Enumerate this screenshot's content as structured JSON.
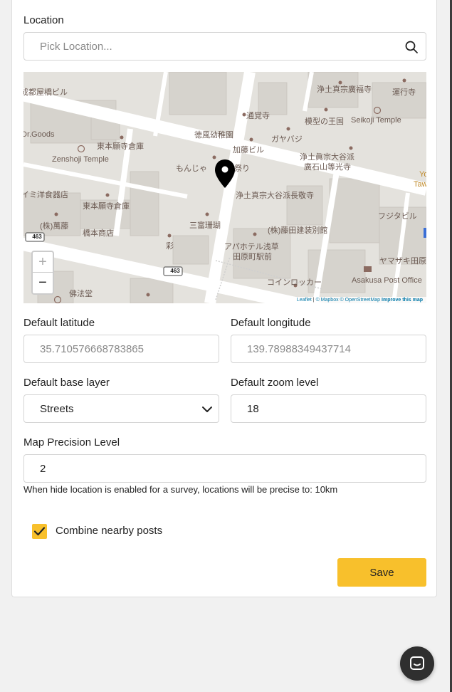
{
  "location": {
    "label": "Location",
    "placeholder": "Pick Location..."
  },
  "map": {
    "labels": [
      {
        "name": "map-label-1",
        "text": "成都屋橋ビル"
      },
      {
        "name": "map-label-2",
        "text": "Dr.Goods"
      },
      {
        "name": "map-label-3",
        "text": "東本願寺倉庫"
      },
      {
        "name": "map-label-4",
        "text": "Zenshoji Temple"
      },
      {
        "name": "map-label-5",
        "text": "イミ洋食器店"
      },
      {
        "name": "map-label-6",
        "text": "東本願寺倉庫"
      },
      {
        "name": "map-label-7",
        "text": "(株)萬藤"
      },
      {
        "name": "map-label-8",
        "text": "橋本商店"
      },
      {
        "name": "map-label-9",
        "text": "徳風幼稚園"
      },
      {
        "name": "map-label-10",
        "text": "通覚寺"
      },
      {
        "name": "map-label-11",
        "text": "浄土真宗廣福寺"
      },
      {
        "name": "map-label-12",
        "text": "運行寺"
      },
      {
        "name": "map-label-13",
        "text": "模型の王国"
      },
      {
        "name": "map-label-14",
        "text": "Seikoji Temple"
      },
      {
        "name": "map-label-15",
        "text": "ガヤバジ"
      },
      {
        "name": "map-label-16",
        "text": "加藤ビル"
      },
      {
        "name": "map-label-17",
        "text": "浄土眞宗大谷派"
      },
      {
        "name": "map-label-18",
        "text": "廣石山等光寺"
      },
      {
        "name": "map-label-19",
        "text": "もんじゃ"
      },
      {
        "name": "map-label-20",
        "text": "祭り"
      },
      {
        "name": "map-label-21",
        "text": "浄土真宗大谷派長敬寺"
      },
      {
        "name": "map-label-22",
        "text": "フジタビル"
      },
      {
        "name": "map-label-23",
        "text": "三富珊瑚"
      },
      {
        "name": "map-label-24",
        "text": "(株)藤田建装別館"
      },
      {
        "name": "map-label-25",
        "text": "彩"
      },
      {
        "name": "map-label-26",
        "text": "アパホテル浅草"
      },
      {
        "name": "map-label-27",
        "text": "田原町駅前"
      },
      {
        "name": "map-label-28",
        "text": "ヤマザキ田原"
      },
      {
        "name": "map-label-29",
        "text": "コインロッカー"
      },
      {
        "name": "map-label-30",
        "text": "Asakusa Post Office"
      },
      {
        "name": "map-label-31",
        "text": "佛法堂"
      },
      {
        "name": "map-label-32",
        "text": "Yo"
      },
      {
        "name": "map-label-33",
        "text": "Taw"
      }
    ],
    "route_badge": "463",
    "zoom_in": "+",
    "zoom_out": "−",
    "attribution": {
      "leaflet": "Leaflet",
      "mapbox": "© Mapbox",
      "osm": "© OpenStreetMap",
      "improve": "Improve this map"
    }
  },
  "latitude": {
    "label": "Default latitude",
    "placeholder": "35.710576668783865"
  },
  "longitude": {
    "label": "Default longitude",
    "placeholder": "139.78988349437714"
  },
  "base_layer": {
    "label": "Default base layer",
    "value": "Streets"
  },
  "zoom_level": {
    "label": "Default zoom level",
    "value": "18"
  },
  "precision": {
    "label": "Map Precision Level",
    "value": "2",
    "help": "When hide location is enabled for a survey, locations will be precise to: 10km"
  },
  "combine": {
    "label": "Combine nearby posts",
    "checked": true
  },
  "save_label": "Save",
  "colors": {
    "accent": "#f8c02c",
    "chat": "#2f2f2f"
  }
}
